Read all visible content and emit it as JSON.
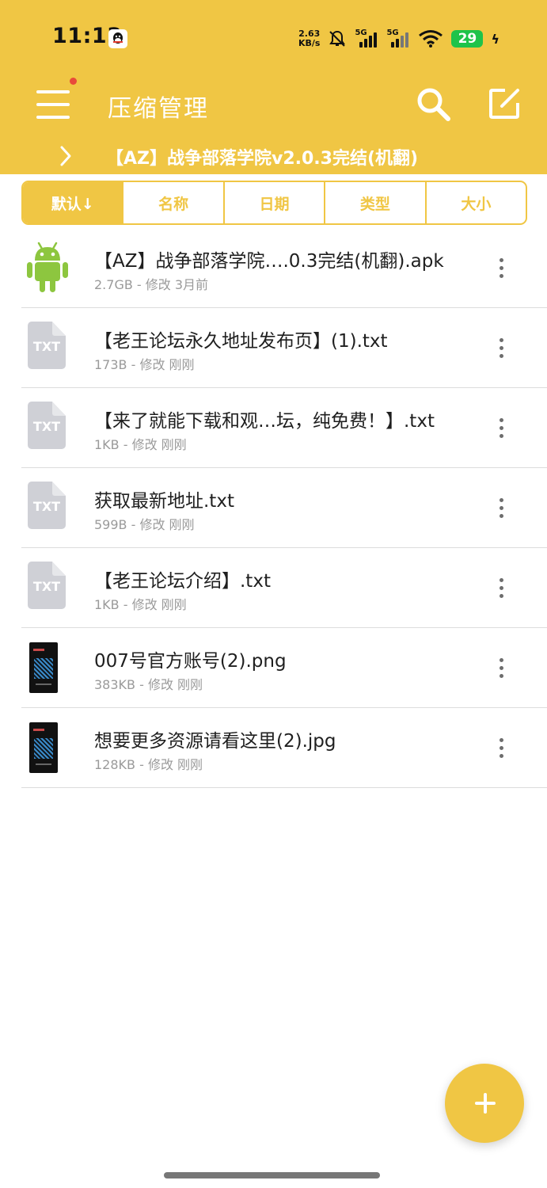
{
  "status_bar": {
    "time": "11:13",
    "net_speed_value": "2.63",
    "net_speed_unit": "KB/s",
    "sim1": "5G",
    "sim2": "5G",
    "battery": "29"
  },
  "app_bar": {
    "title": "压缩管理"
  },
  "path": {
    "current": "【AZ】战争部落学院v2.0.3完结(机翻)"
  },
  "sort_tabs": [
    {
      "label": "默认↓",
      "active": true
    },
    {
      "label": "名称",
      "active": false
    },
    {
      "label": "日期",
      "active": false
    },
    {
      "label": "类型",
      "active": false
    },
    {
      "label": "大小",
      "active": false
    }
  ],
  "files": [
    {
      "name": "【AZ】战争部落学院….0.3完结(机翻).apk",
      "meta": "2.7GB - 修改 3月前",
      "icon": "android-icon"
    },
    {
      "name": "【老王论坛永久地址发布页】(1).txt",
      "meta": "173B - 修改 刚刚",
      "icon": "txt-file-icon",
      "icon_text": "TXT"
    },
    {
      "name": "【来了就能下载和观…坛，纯免费！】.txt",
      "meta": "1KB - 修改 刚刚",
      "icon": "txt-file-icon",
      "icon_text": "TXT"
    },
    {
      "name": "获取最新地址.txt",
      "meta": "599B - 修改 刚刚",
      "icon": "txt-file-icon",
      "icon_text": "TXT"
    },
    {
      "name": "【老王论坛介绍】.txt",
      "meta": "1KB - 修改 刚刚",
      "icon": "txt-file-icon",
      "icon_text": "TXT"
    },
    {
      "name": "007号官方账号(2).png",
      "meta": "383KB - 修改 刚刚",
      "icon": "image-thumbnail"
    },
    {
      "name": "想要更多资源请看这里(2).jpg",
      "meta": "128KB - 修改 刚刚",
      "icon": "image-thumbnail"
    }
  ],
  "colors": {
    "accent": "#f0c644",
    "android": "#8dc63f",
    "txt_icon": "#cfd0d6",
    "battery": "#1ec34a",
    "notification_dot": "#e84a3a"
  }
}
